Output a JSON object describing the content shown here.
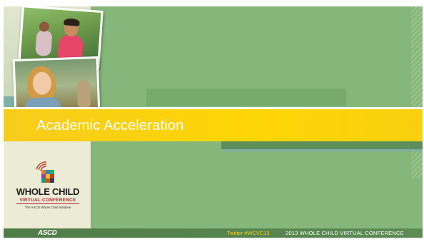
{
  "slide": {
    "title": "Academic Acceleration",
    "colors": {
      "background": "#86b77a",
      "title_bar": "#fed504",
      "footer": "#4f7b47",
      "left_panel": "#ecebd5"
    }
  },
  "branding": {
    "logo_icon": "whole-child-mosaic-icon",
    "logo_title": "WHOLE CHILD",
    "logo_subtitle": "VIRTUAL CONFERENCE",
    "logo_tagline": "The ASCD Whole Child Initiative"
  },
  "footer": {
    "publisher": "ASCD",
    "twitter": "Twitter #WCVC13",
    "conference": "2013 WHOLE CHILD VIRTUAL CONFERENCE"
  }
}
